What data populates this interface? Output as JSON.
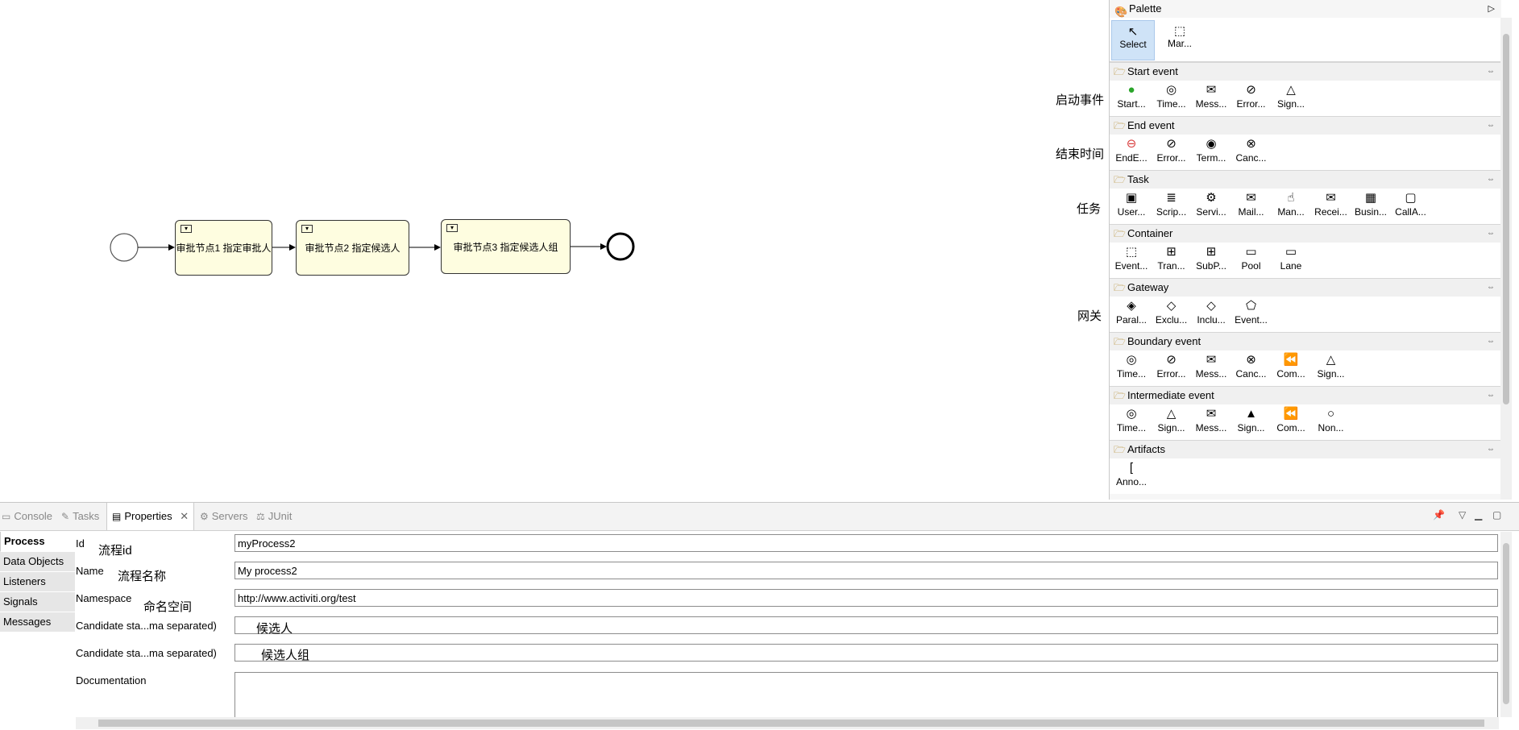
{
  "diagram": {
    "tasks": [
      {
        "label": "审批节点1 指定审批人"
      },
      {
        "label": "审批节点2 指定候选人"
      },
      {
        "label": "审批节点3 指定候选人组"
      }
    ]
  },
  "annotations": {
    "start_event": "启动事件",
    "end_event": "结束时间",
    "task": "任务",
    "gateway": "网关",
    "process_id": "流程id",
    "process_name": "流程名称",
    "namespace": "命名空间",
    "candidate_users": "候选人",
    "candidate_groups": "候选人组"
  },
  "palette": {
    "title": "Palette",
    "tools": [
      {
        "label": "Select",
        "icon": "pointer-icon"
      },
      {
        "label": "Mar...",
        "icon": "marquee-icon"
      }
    ],
    "drawers": [
      {
        "name": "Start event",
        "items": [
          {
            "label": "Start...",
            "icon": "start-event-icon"
          },
          {
            "label": "Time...",
            "icon": "timer-icon"
          },
          {
            "label": "Mess...",
            "icon": "message-icon"
          },
          {
            "label": "Error...",
            "icon": "error-icon"
          },
          {
            "label": "Sign...",
            "icon": "signal-icon"
          }
        ]
      },
      {
        "name": "End event",
        "items": [
          {
            "label": "EndE...",
            "icon": "end-event-icon"
          },
          {
            "label": "Error...",
            "icon": "error-icon"
          },
          {
            "label": "Term...",
            "icon": "terminate-icon"
          },
          {
            "label": "Canc...",
            "icon": "cancel-icon"
          }
        ]
      },
      {
        "name": "Task",
        "items": [
          {
            "label": "User...",
            "icon": "user-task-icon"
          },
          {
            "label": "Scrip...",
            "icon": "script-icon"
          },
          {
            "label": "Servi...",
            "icon": "gear-icon"
          },
          {
            "label": "Mail...",
            "icon": "mail-icon"
          },
          {
            "label": "Man...",
            "icon": "manual-icon"
          },
          {
            "label": "Recei...",
            "icon": "receive-icon"
          },
          {
            "label": "Busin...",
            "icon": "business-rule-icon"
          },
          {
            "label": "CallA...",
            "icon": "call-activity-icon"
          }
        ]
      },
      {
        "name": "Container",
        "items": [
          {
            "label": "Event...",
            "icon": "event-subprocess-icon"
          },
          {
            "label": "Tran...",
            "icon": "transaction-icon"
          },
          {
            "label": "SubP...",
            "icon": "subprocess-icon"
          },
          {
            "label": "Pool",
            "icon": "pool-icon"
          },
          {
            "label": "Lane",
            "icon": "lane-icon"
          }
        ]
      },
      {
        "name": "Gateway",
        "items": [
          {
            "label": "Paral...",
            "icon": "parallel-gateway-icon"
          },
          {
            "label": "Exclu...",
            "icon": "exclusive-gateway-icon"
          },
          {
            "label": "Inclu...",
            "icon": "inclusive-gateway-icon"
          },
          {
            "label": "Event...",
            "icon": "event-gateway-icon"
          }
        ]
      },
      {
        "name": "Boundary event",
        "items": [
          {
            "label": "Time...",
            "icon": "timer-icon"
          },
          {
            "label": "Error...",
            "icon": "error-icon"
          },
          {
            "label": "Mess...",
            "icon": "message-icon"
          },
          {
            "label": "Canc...",
            "icon": "cancel-icon"
          },
          {
            "label": "Com...",
            "icon": "compensation-icon"
          },
          {
            "label": "Sign...",
            "icon": "signal-icon"
          }
        ]
      },
      {
        "name": "Intermediate event",
        "items": [
          {
            "label": "Time...",
            "icon": "timer-icon"
          },
          {
            "label": "Sign...",
            "icon": "signal-icon"
          },
          {
            "label": "Mess...",
            "icon": "message-icon"
          },
          {
            "label": "Sign...",
            "icon": "signal-throw-icon"
          },
          {
            "label": "Com...",
            "icon": "compensation-icon"
          },
          {
            "label": "Non...",
            "icon": "none-event-icon"
          }
        ]
      },
      {
        "name": "Artifacts",
        "items": [
          {
            "label": "Anno...",
            "icon": "annotation-icon"
          }
        ]
      }
    ]
  },
  "views": {
    "tabs": [
      {
        "label": "Console",
        "icon": "console-icon"
      },
      {
        "label": "Tasks",
        "icon": "tasks-icon"
      },
      {
        "label": "Properties",
        "icon": "properties-icon"
      },
      {
        "label": "Servers",
        "icon": "servers-icon"
      },
      {
        "label": "JUnit",
        "icon": "junit-icon"
      }
    ]
  },
  "properties": {
    "side_tabs": [
      "Process",
      "Data Objects",
      "Listeners",
      "Signals",
      "Messages"
    ],
    "fields": {
      "id_label": "Id",
      "id_value": "myProcess2",
      "name_label": "Name",
      "name_value": "My process2",
      "namespace_label": "Namespace",
      "namespace_value": "http://www.activiti.org/test",
      "cand_users_label": "Candidate sta...ma separated)",
      "cand_users_value": "",
      "cand_groups_label": "Candidate sta...ma separated)",
      "cand_groups_value": "",
      "documentation_label": "Documentation",
      "documentation_value": ""
    }
  },
  "colors": {
    "task_fill": "#fefde0",
    "start_event_green": "#2aa52a",
    "end_event_red": "#d83a3a",
    "selected_tool": "#cfe3f7"
  }
}
